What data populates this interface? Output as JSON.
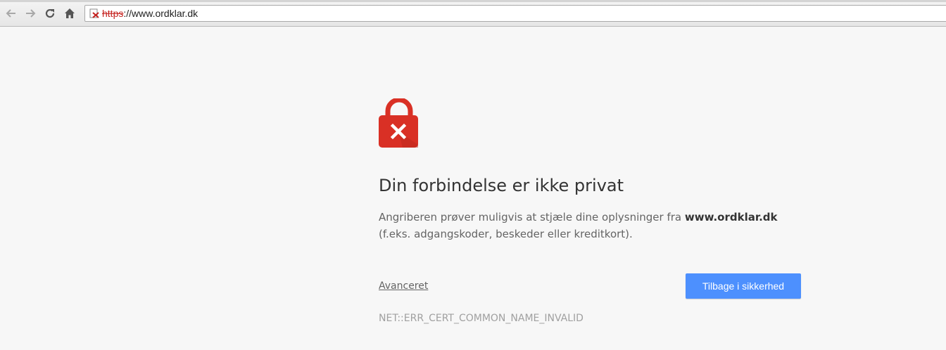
{
  "browser": {
    "url_scheme": "https",
    "url_rest": "://www.ordklar.dk",
    "icons": {
      "back": "arrow-left-icon",
      "forward": "arrow-right-icon",
      "reload": "reload-icon",
      "home": "home-icon",
      "security": "insecure-lock-icon"
    }
  },
  "interstitial": {
    "icon": "red-lock-x-icon",
    "heading": "Din forbindelse er ikke privat",
    "message_before": "Angriberen prøver muligvis at stjæle dine oplysninger fra ",
    "message_host": "www.ordklar.dk",
    "message_after": " (f.eks. adgangskoder, beskeder eller kreditkort).",
    "advanced_link": "Avanceret",
    "primary_button": "Tilbage i sikkerhed",
    "error_code": "NET::ERR_CERT_COMMON_NAME_INVALID"
  },
  "colors": {
    "lock_red": "#d93025",
    "button_blue": "#4d90fe",
    "page_bg": "#f7f7f7"
  }
}
